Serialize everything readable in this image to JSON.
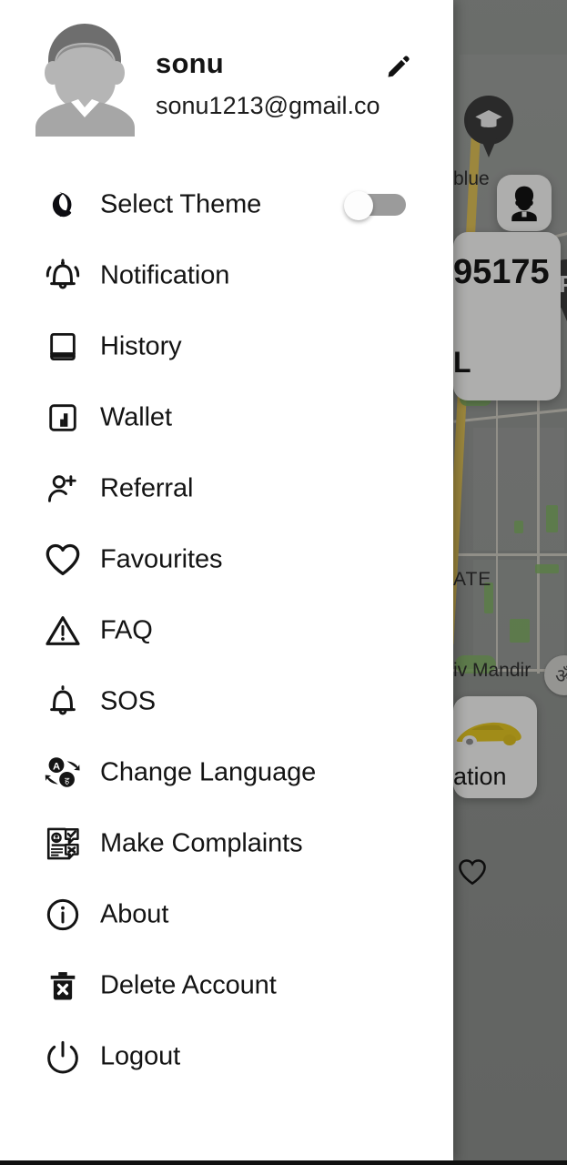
{
  "drawer": {
    "profile": {
      "avatar_icon": "default-user-avatar",
      "username": "sonu",
      "email": "sonu1213@gmail.co",
      "edit_icon": "pencil-icon"
    },
    "menu_items": [
      {
        "id": "select-theme",
        "label": "Select Theme",
        "icon": "moon-icon",
        "has_toggle": true,
        "toggle_on": false
      },
      {
        "id": "notification",
        "label": "Notification",
        "icon": "bell-ringing-icon",
        "has_toggle": false
      },
      {
        "id": "history",
        "label": "History",
        "icon": "book-icon",
        "has_toggle": false
      },
      {
        "id": "wallet",
        "label": "Wallet",
        "icon": "wallet-icon",
        "has_toggle": false
      },
      {
        "id": "referral",
        "label": "Referral",
        "icon": "person-add-icon",
        "has_toggle": false
      },
      {
        "id": "favourites",
        "label": "Favourites",
        "icon": "heart-icon",
        "has_toggle": false
      },
      {
        "id": "faq",
        "label": "FAQ",
        "icon": "warning-triangle-icon",
        "has_toggle": false
      },
      {
        "id": "sos",
        "label": "SOS",
        "icon": "bell-icon",
        "has_toggle": false
      },
      {
        "id": "change-language",
        "label": "Change Language",
        "icon": "translate-icon",
        "has_toggle": false
      },
      {
        "id": "make-complaints",
        "label": "Make Complaints",
        "icon": "complaint-document-icon",
        "has_toggle": false
      },
      {
        "id": "about",
        "label": "About",
        "icon": "info-circle-icon",
        "has_toggle": false
      },
      {
        "id": "delete-account",
        "label": "Delete Account",
        "icon": "trash-x-icon",
        "has_toggle": false
      },
      {
        "id": "logout",
        "label": "Logout",
        "icon": "power-icon",
        "has_toggle": false
      }
    ]
  },
  "map": {
    "labels": {
      "blue": "blue",
      "estate": "ATE",
      "shiv_mandir": "iv Mandir"
    },
    "markers": {
      "school_pin": "graduation-cap-pin",
      "temple_icon": "om-temple-icon",
      "parking_pin": "parking-pin"
    },
    "cards": {
      "driver_avatar": "driver-avatar-card",
      "trip_number": "95175",
      "trip_suffix": "L",
      "vehicle": "yellow-taxi-icon",
      "location_text": "ation"
    },
    "favourite_icon": "heart-outline-icon"
  },
  "colors": {
    "drawer_bg": "#ffffff",
    "text_primary": "#141414",
    "toggle_track": "#9b9b9b",
    "toggle_knob": "#fdfdfd",
    "map_base": "#8f928f",
    "map_road_yellow": "#d9bb55",
    "scrim": "rgba(0,0,0,0.28)"
  }
}
